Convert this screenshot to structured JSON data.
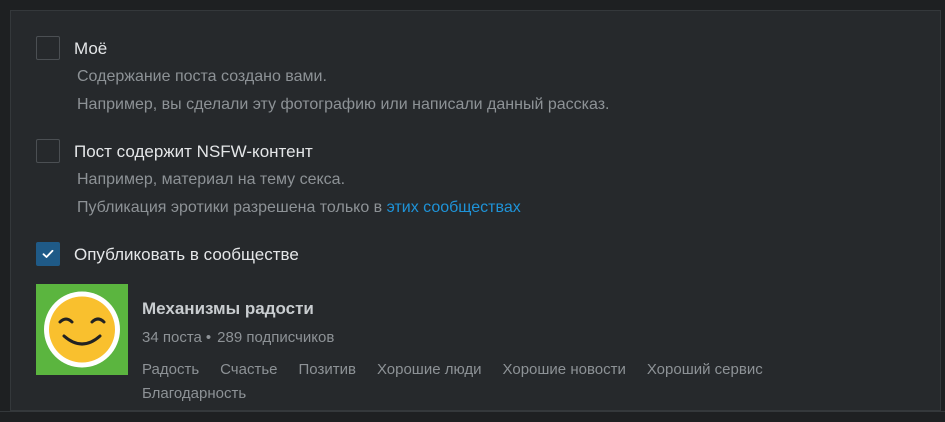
{
  "options": [
    {
      "label": "Моё",
      "checked": false,
      "hints": [
        "Содержание поста создано вами.",
        "Например, вы сделали эту фотографию или написали данный рассказ."
      ]
    },
    {
      "label": "Пост содержит NSFW-контент",
      "checked": false,
      "hints": [
        "Например, материал на тему секса."
      ],
      "hint_with_link": {
        "text": "Публикация эротики разрешена только в ",
        "link": "этих сообществах"
      }
    },
    {
      "label": "Опубликовать в сообществе",
      "checked": true
    }
  ],
  "community": {
    "name": "Механизмы радости",
    "posts": "34 поста",
    "separator": "•",
    "subscribers": "289 подписчиков",
    "avatar_icon": "smiley-face-icon",
    "tags": [
      "Радость",
      "Счастье",
      "Позитив",
      "Хорошие люди",
      "Хорошие новости",
      "Хороший сервис",
      "Благодарность"
    ]
  },
  "colors": {
    "background": "#1e2022",
    "panel": "#26292c",
    "checkbox_checked": "#1f5a87",
    "link": "#1e93d8",
    "avatar_bg": "#5bb53f",
    "smiley": "#f9c02e"
  }
}
